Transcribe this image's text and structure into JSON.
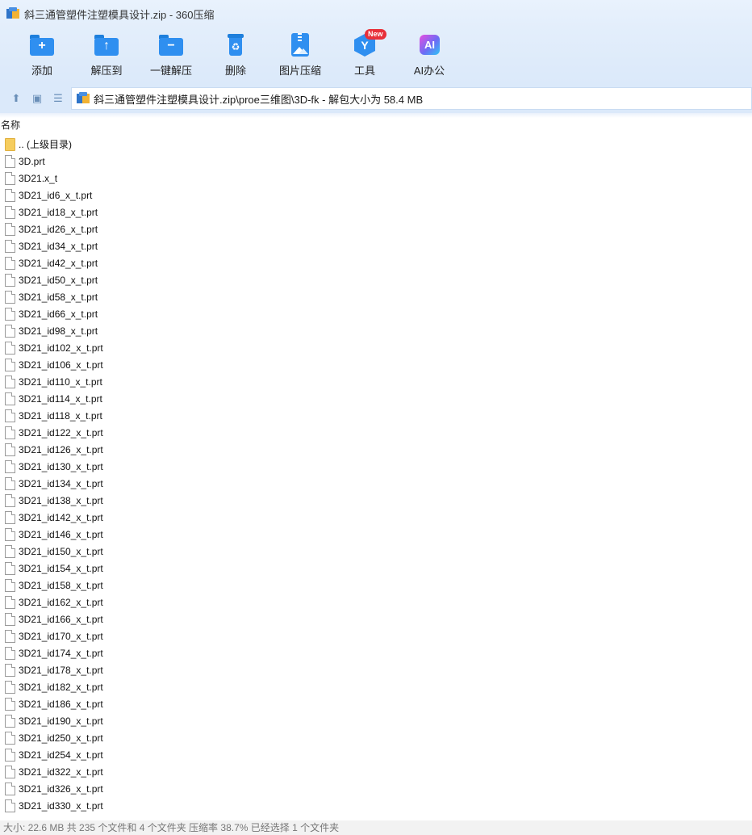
{
  "window": {
    "title": "斜三通管塑件注塑模具设计.zip - 360压缩"
  },
  "toolbar": [
    {
      "id": "add",
      "label": "添加",
      "icon": "folder-add-icon"
    },
    {
      "id": "extract-to",
      "label": "解压到",
      "icon": "folder-extract-icon"
    },
    {
      "id": "one-click-extract",
      "label": "一键解压",
      "icon": "folder-extract-all-icon"
    },
    {
      "id": "delete",
      "label": "删除",
      "icon": "trash-icon"
    },
    {
      "id": "image-compress",
      "label": "图片压缩",
      "icon": "image-compress-icon"
    },
    {
      "id": "tools",
      "label": "工具",
      "icon": "tools-icon",
      "badge": "New"
    },
    {
      "id": "ai-office",
      "label": "AI办公",
      "icon": "ai-office-icon",
      "icon_text": "AI"
    }
  ],
  "address": {
    "path": "斜三通管塑件注塑模具设计.zip\\proe三维图\\3D-fk - 解包大小为 58.4 MB"
  },
  "list": {
    "column_name": "名称",
    "items": [
      {
        "name": ".. (上级目录)",
        "type": "folder"
      },
      {
        "name": "3D.prt",
        "type": "file"
      },
      {
        "name": "3D21.x_t",
        "type": "file"
      },
      {
        "name": "3D21_id6_x_t.prt",
        "type": "file"
      },
      {
        "name": "3D21_id18_x_t.prt",
        "type": "file"
      },
      {
        "name": "3D21_id26_x_t.prt",
        "type": "file"
      },
      {
        "name": "3D21_id34_x_t.prt",
        "type": "file"
      },
      {
        "name": "3D21_id42_x_t.prt",
        "type": "file"
      },
      {
        "name": "3D21_id50_x_t.prt",
        "type": "file"
      },
      {
        "name": "3D21_id58_x_t.prt",
        "type": "file"
      },
      {
        "name": "3D21_id66_x_t.prt",
        "type": "file"
      },
      {
        "name": "3D21_id98_x_t.prt",
        "type": "file"
      },
      {
        "name": "3D21_id102_x_t.prt",
        "type": "file"
      },
      {
        "name": "3D21_id106_x_t.prt",
        "type": "file"
      },
      {
        "name": "3D21_id110_x_t.prt",
        "type": "file"
      },
      {
        "name": "3D21_id114_x_t.prt",
        "type": "file"
      },
      {
        "name": "3D21_id118_x_t.prt",
        "type": "file"
      },
      {
        "name": "3D21_id122_x_t.prt",
        "type": "file"
      },
      {
        "name": "3D21_id126_x_t.prt",
        "type": "file"
      },
      {
        "name": "3D21_id130_x_t.prt",
        "type": "file"
      },
      {
        "name": "3D21_id134_x_t.prt",
        "type": "file"
      },
      {
        "name": "3D21_id138_x_t.prt",
        "type": "file"
      },
      {
        "name": "3D21_id142_x_t.prt",
        "type": "file"
      },
      {
        "name": "3D21_id146_x_t.prt",
        "type": "file"
      },
      {
        "name": "3D21_id150_x_t.prt",
        "type": "file"
      },
      {
        "name": "3D21_id154_x_t.prt",
        "type": "file"
      },
      {
        "name": "3D21_id158_x_t.prt",
        "type": "file"
      },
      {
        "name": "3D21_id162_x_t.prt",
        "type": "file"
      },
      {
        "name": "3D21_id166_x_t.prt",
        "type": "file"
      },
      {
        "name": "3D21_id170_x_t.prt",
        "type": "file"
      },
      {
        "name": "3D21_id174_x_t.prt",
        "type": "file"
      },
      {
        "name": "3D21_id178_x_t.prt",
        "type": "file"
      },
      {
        "name": "3D21_id182_x_t.prt",
        "type": "file"
      },
      {
        "name": "3D21_id186_x_t.prt",
        "type": "file"
      },
      {
        "name": "3D21_id190_x_t.prt",
        "type": "file"
      },
      {
        "name": "3D21_id250_x_t.prt",
        "type": "file"
      },
      {
        "name": "3D21_id254_x_t.prt",
        "type": "file"
      },
      {
        "name": "3D21_id322_x_t.prt",
        "type": "file"
      },
      {
        "name": "3D21_id326_x_t.prt",
        "type": "file"
      },
      {
        "name": "3D21_id330_x_t.prt",
        "type": "file"
      }
    ]
  },
  "status": {
    "text": "大小: 22.6 MB 共 235 个文件和 4 个文件夹 压缩率 38.7% 已经选择 1 个文件夹"
  },
  "colors": {
    "accent": "#2f8ff0",
    "toolbar_bg": "#dbe9fa",
    "folder": "#f6cd5e",
    "badge": "#e8303a"
  }
}
